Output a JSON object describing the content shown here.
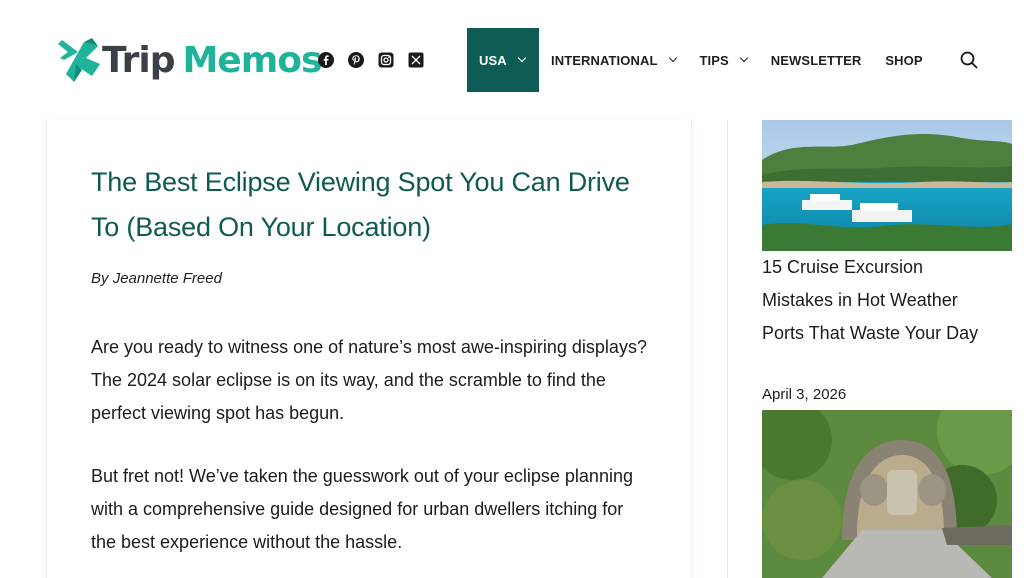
{
  "brand": {
    "name_part1": "Trip",
    "name_part2": "Memos",
    "colors": {
      "primary": "#1fb39a",
      "dark": "#3b3f46",
      "nav_active": "#0d5c55",
      "title": "#0f5b52"
    }
  },
  "social": [
    "facebook-icon",
    "pinterest-icon",
    "instagram-icon",
    "x-twitter-icon"
  ],
  "nav": {
    "items": [
      {
        "label": "USA",
        "has_dropdown": true,
        "active": true
      },
      {
        "label": "INTERNATIONAL",
        "has_dropdown": true,
        "active": false
      },
      {
        "label": "TIPS",
        "has_dropdown": true,
        "active": false
      },
      {
        "label": "NEWSLETTER",
        "has_dropdown": false,
        "active": false
      },
      {
        "label": "SHOP",
        "has_dropdown": false,
        "active": false
      }
    ],
    "search_icon": "search-icon"
  },
  "article": {
    "title": "The Best Eclipse Viewing Spot You Can Drive To (Based On Your Location)",
    "byline_prefix": "By",
    "author": "Jeannette Freed",
    "paragraphs": [
      "Are you ready to witness one of nature’s most awe-inspiring displays? The 2024 solar eclipse is on its way, and the scramble to find the perfect viewing spot has begun.",
      "But fret not! We’ve taken the guesswork out of your eclipse planning with a comprehensive guide designed for urban dwellers itching for the best experience without the hassle."
    ]
  },
  "sidebar": {
    "posts": [
      {
        "title": "15 Cruise Excursion Mistakes in Hot Weather Ports That Waste Your Day",
        "date": "April 3, 2026",
        "image": "cruise-port-bay"
      },
      {
        "title": "",
        "date": "",
        "image": "stone-face-sculpture"
      }
    ]
  }
}
